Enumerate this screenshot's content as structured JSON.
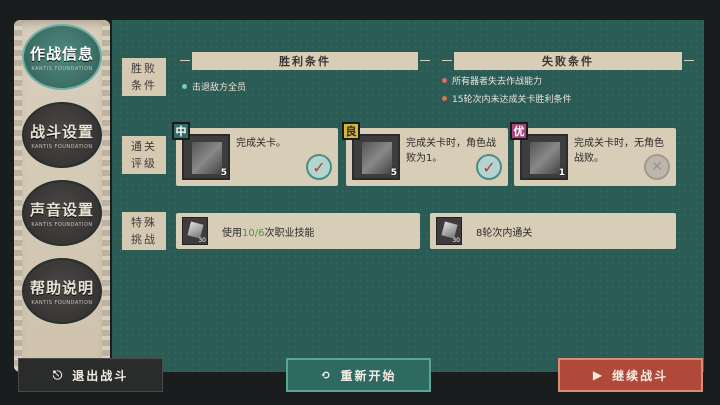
{
  "nav": {
    "items": [
      {
        "label": "作战信息",
        "sub": "KANTIS FOUNDATION"
      },
      {
        "label": "战斗设置",
        "sub": "KANTIS FOUNDATION"
      },
      {
        "label": "声音设置",
        "sub": "KANTIS FOUNDATION"
      },
      {
        "label": "帮助说明",
        "sub": "KANTIS FOUNDATION"
      }
    ],
    "active_index": 0
  },
  "conditions": {
    "label_line1": "胜败",
    "label_line2": "条件",
    "win_header": "胜利条件",
    "lose_header": "失败条件",
    "win_items": [
      "击退敌方全员"
    ],
    "lose_items": [
      "所有器者失去作战能力",
      "15轮次内未达成关卡胜利条件"
    ]
  },
  "clear_rating": {
    "label_line1": "通关",
    "label_line2": "评级",
    "cards": [
      {
        "grade": "中",
        "text": "完成关卡。",
        "count": "5",
        "achieved": true
      },
      {
        "grade": "良",
        "text": "完成关卡时，角色战败为1。",
        "count": "5",
        "achieved": true
      },
      {
        "grade": "优",
        "text": "完成关卡时，无角色战败。",
        "count": "1",
        "achieved": false
      }
    ]
  },
  "special": {
    "label_line1": "特殊",
    "label_line2": "挑战",
    "items": [
      {
        "count": "30",
        "prefix": "使用",
        "highlight": "10/6",
        "suffix": "次职业技能"
      },
      {
        "count": "30",
        "prefix": "8轮次内通关",
        "highlight": "",
        "suffix": ""
      }
    ]
  },
  "buttons": {
    "exit": "退出战斗",
    "restart": "重新开始",
    "continue": "继续战斗"
  },
  "colors": {
    "panel_bg": "#2b5b55",
    "card_bg": "#d8cdb7",
    "accent_red": "#b0493a",
    "accent_teal": "#2f6a62",
    "highlight_green": "#3f9e3a"
  }
}
